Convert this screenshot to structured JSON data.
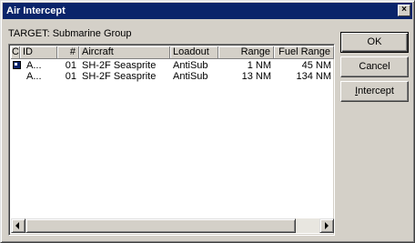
{
  "window": {
    "title": "Air Intercept",
    "close_glyph": "×"
  },
  "target_label": "TARGET: Submarine Group",
  "table": {
    "columns": [
      "C",
      "ID",
      "#",
      "Aircraft",
      "Loadout",
      "Range",
      "Fuel Range"
    ],
    "rows": [
      {
        "id": "A...",
        "num": "01",
        "aircraft": "SH-2F Seasprite",
        "loadout": "AntiSub",
        "range": "1 NM",
        "fuel_range": "45 NM",
        "selected_flag": true
      },
      {
        "id": "A...",
        "num": "01",
        "aircraft": "SH-2F Seasprite",
        "loadout": "AntiSub",
        "range": "13 NM",
        "fuel_range": "134 NM",
        "selected_flag": false
      }
    ]
  },
  "buttons": {
    "ok": "OK",
    "cancel": "Cancel",
    "intercept_first": "I",
    "intercept_rest": "ntercept"
  },
  "colors": {
    "titlebar": "#0a246a",
    "face": "#d4d0c8"
  }
}
